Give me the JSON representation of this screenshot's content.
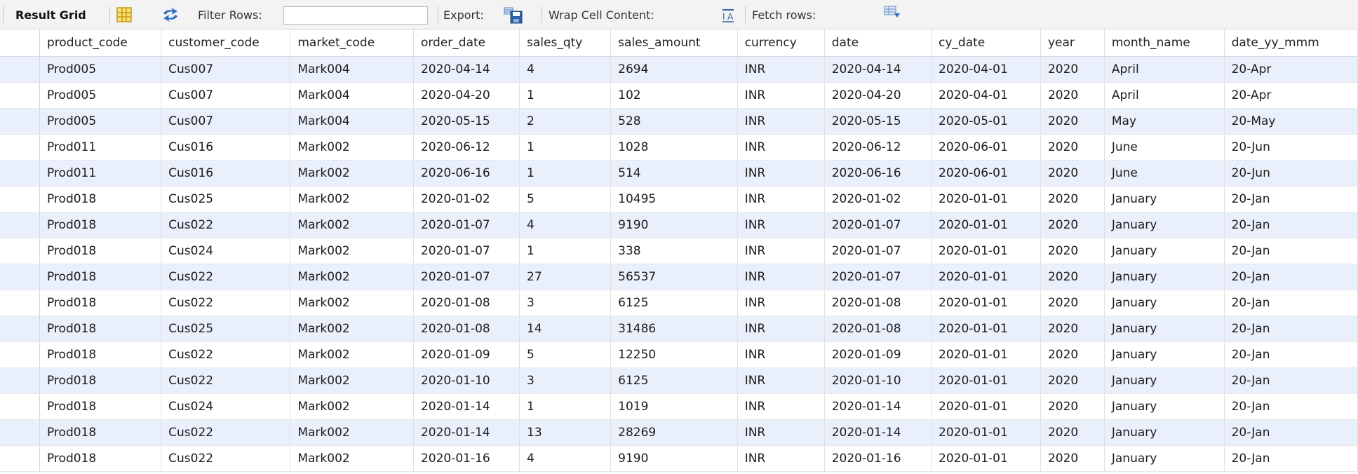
{
  "toolbar": {
    "result_grid_label": "Result Grid",
    "filter_rows_label": "Filter Rows:",
    "filter_rows_value": "",
    "export_label": "Export:",
    "wrap_cell_label": "Wrap Cell Content:",
    "fetch_rows_label": "Fetch rows:",
    "icons": [
      "grid-view-icon",
      "refresh-arrows-icon",
      "export-save-icon",
      "wrap-text-icon",
      "fetch-rows-icon"
    ]
  },
  "grid": {
    "columns": [
      "product_code",
      "customer_code",
      "market_code",
      "order_date",
      "sales_qty",
      "sales_amount",
      "currency",
      "date",
      "cy_date",
      "year",
      "month_name",
      "date_yy_mmm"
    ],
    "rows": [
      [
        "Prod005",
        "Cus007",
        "Mark004",
        "2020-04-14",
        "4",
        "2694",
        "INR",
        "2020-04-14",
        "2020-04-01",
        "2020",
        "April",
        "20-Apr"
      ],
      [
        "Prod005",
        "Cus007",
        "Mark004",
        "2020-04-20",
        "1",
        "102",
        "INR",
        "2020-04-20",
        "2020-04-01",
        "2020",
        "April",
        "20-Apr"
      ],
      [
        "Prod005",
        "Cus007",
        "Mark004",
        "2020-05-15",
        "2",
        "528",
        "INR",
        "2020-05-15",
        "2020-05-01",
        "2020",
        "May",
        "20-May"
      ],
      [
        "Prod011",
        "Cus016",
        "Mark002",
        "2020-06-12",
        "1",
        "1028",
        "INR",
        "2020-06-12",
        "2020-06-01",
        "2020",
        "June",
        "20-Jun"
      ],
      [
        "Prod011",
        "Cus016",
        "Mark002",
        "2020-06-16",
        "1",
        "514",
        "INR",
        "2020-06-16",
        "2020-06-01",
        "2020",
        "June",
        "20-Jun"
      ],
      [
        "Prod018",
        "Cus025",
        "Mark002",
        "2020-01-02",
        "5",
        "10495",
        "INR",
        "2020-01-02",
        "2020-01-01",
        "2020",
        "January",
        "20-Jan"
      ],
      [
        "Prod018",
        "Cus022",
        "Mark002",
        "2020-01-07",
        "4",
        "9190",
        "INR",
        "2020-01-07",
        "2020-01-01",
        "2020",
        "January",
        "20-Jan"
      ],
      [
        "Prod018",
        "Cus024",
        "Mark002",
        "2020-01-07",
        "1",
        "338",
        "INR",
        "2020-01-07",
        "2020-01-01",
        "2020",
        "January",
        "20-Jan"
      ],
      [
        "Prod018",
        "Cus022",
        "Mark002",
        "2020-01-07",
        "27",
        "56537",
        "INR",
        "2020-01-07",
        "2020-01-01",
        "2020",
        "January",
        "20-Jan"
      ],
      [
        "Prod018",
        "Cus022",
        "Mark002",
        "2020-01-08",
        "3",
        "6125",
        "INR",
        "2020-01-08",
        "2020-01-01",
        "2020",
        "January",
        "20-Jan"
      ],
      [
        "Prod018",
        "Cus025",
        "Mark002",
        "2020-01-08",
        "14",
        "31486",
        "INR",
        "2020-01-08",
        "2020-01-01",
        "2020",
        "January",
        "20-Jan"
      ],
      [
        "Prod018",
        "Cus022",
        "Mark002",
        "2020-01-09",
        "5",
        "12250",
        "INR",
        "2020-01-09",
        "2020-01-01",
        "2020",
        "January",
        "20-Jan"
      ],
      [
        "Prod018",
        "Cus022",
        "Mark002",
        "2020-01-10",
        "3",
        "6125",
        "INR",
        "2020-01-10",
        "2020-01-01",
        "2020",
        "January",
        "20-Jan"
      ],
      [
        "Prod018",
        "Cus024",
        "Mark002",
        "2020-01-14",
        "1",
        "1019",
        "INR",
        "2020-01-14",
        "2020-01-01",
        "2020",
        "January",
        "20-Jan"
      ],
      [
        "Prod018",
        "Cus022",
        "Mark002",
        "2020-01-14",
        "13",
        "28269",
        "INR",
        "2020-01-14",
        "2020-01-01",
        "2020",
        "January",
        "20-Jan"
      ],
      [
        "Prod018",
        "Cus022",
        "Mark002",
        "2020-01-16",
        "4",
        "9190",
        "INR",
        "2020-01-16",
        "2020-01-01",
        "2020",
        "January",
        "20-Jan"
      ]
    ]
  },
  "colors": {
    "selected_row_bg": "#e9f0fb",
    "toolbar_bg": "#f3f3f3",
    "icon_blue": "#2f6fbf",
    "icon_yellow": "#e9b321"
  }
}
